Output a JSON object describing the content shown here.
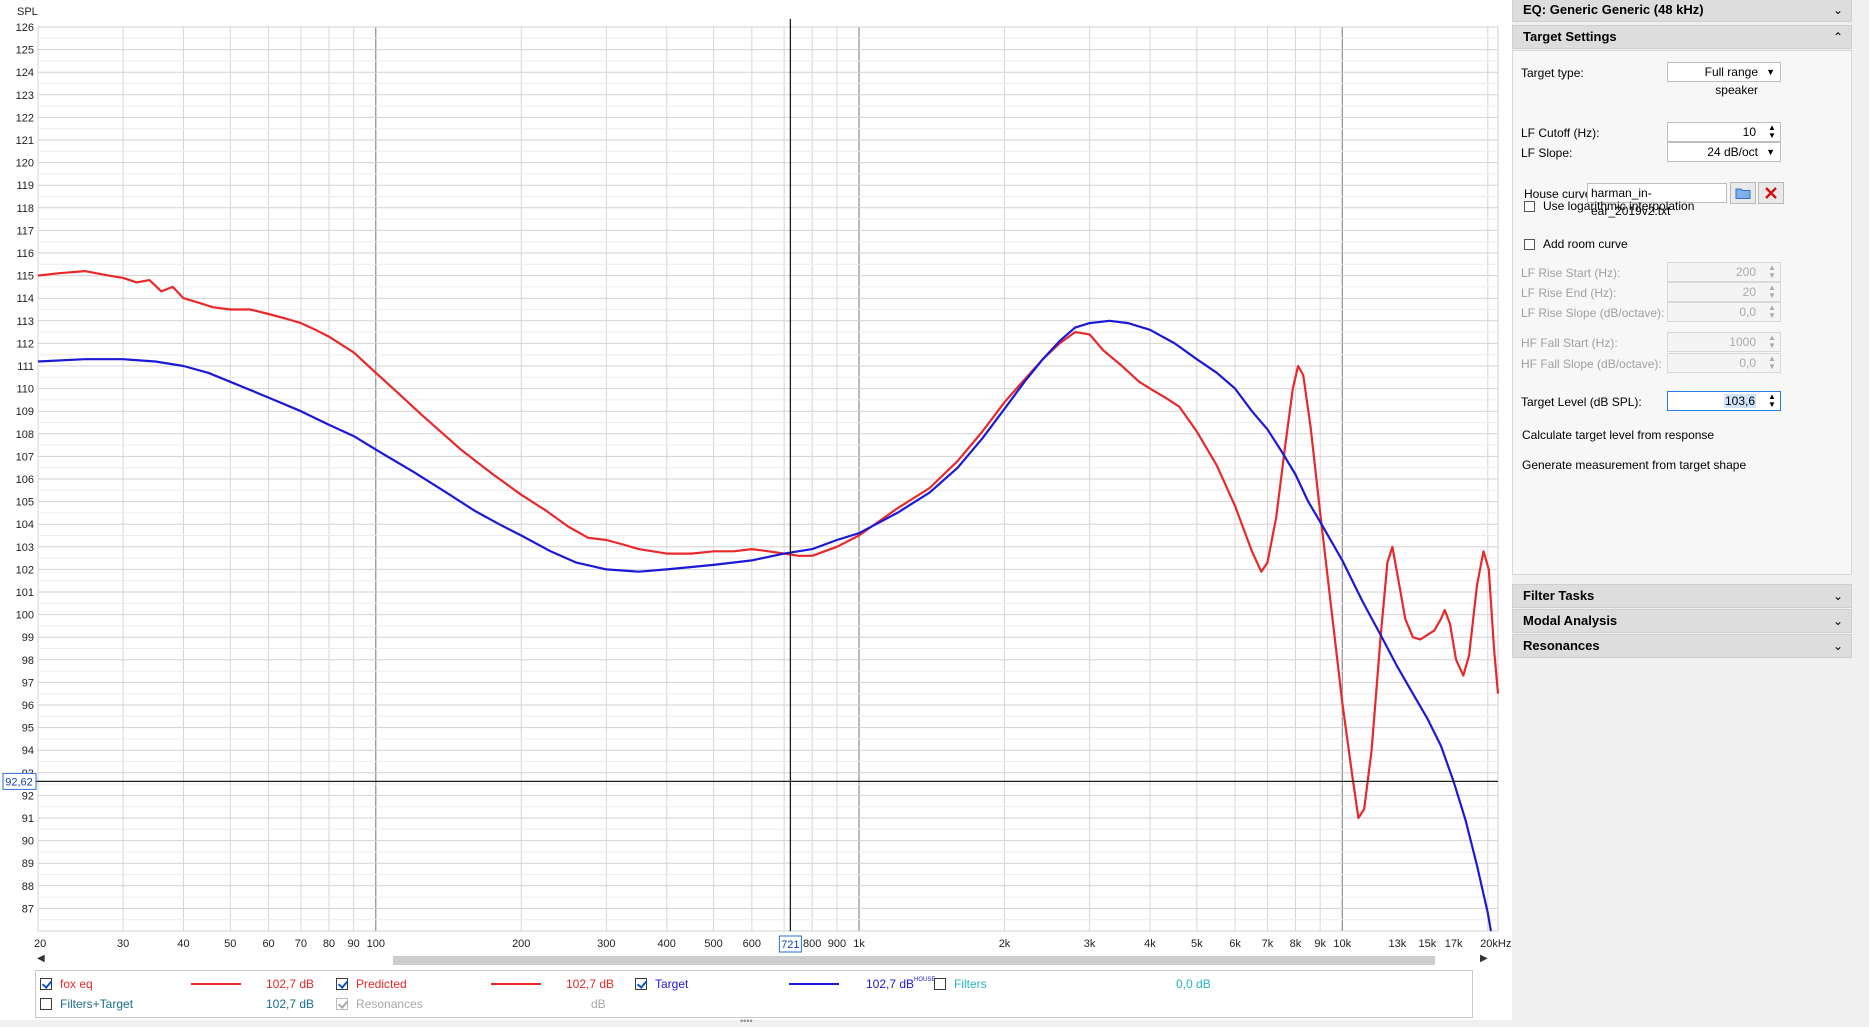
{
  "graph": {
    "y_axis_label": "SPL",
    "cursor": {
      "y_readout": "92,62",
      "x_readout": "721"
    }
  },
  "chart_data": {
    "type": "line",
    "xscale": "log",
    "xlim": [
      20,
      21000
    ],
    "ylim": [
      86,
      126
    ],
    "ylabel": "SPL",
    "grid": true,
    "y_ticks": [
      87,
      88,
      89,
      90,
      91,
      92,
      93,
      94,
      95,
      96,
      97,
      98,
      99,
      100,
      101,
      102,
      103,
      104,
      105,
      106,
      107,
      108,
      109,
      110,
      111,
      112,
      113,
      114,
      115,
      116,
      117,
      118,
      119,
      120,
      121,
      122,
      123,
      124,
      125,
      126
    ],
    "x_ticks": [
      {
        "v": 20,
        "label": "20"
      },
      {
        "v": 30,
        "label": "30"
      },
      {
        "v": 40,
        "label": "40"
      },
      {
        "v": 50,
        "label": "50"
      },
      {
        "v": 60,
        "label": "60"
      },
      {
        "v": 70,
        "label": "70"
      },
      {
        "v": 80,
        "label": "80"
      },
      {
        "v": 90,
        "label": "90"
      },
      {
        "v": 100,
        "label": "100"
      },
      {
        "v": 200,
        "label": "200"
      },
      {
        "v": 300,
        "label": "300"
      },
      {
        "v": 400,
        "label": "400"
      },
      {
        "v": 500,
        "label": "500"
      },
      {
        "v": 600,
        "label": "600"
      },
      {
        "v": 800,
        "label": "800"
      },
      {
        "v": 900,
        "label": "900"
      },
      {
        "v": 1000,
        "label": "1k"
      },
      {
        "v": 2000,
        "label": "2k"
      },
      {
        "v": 3000,
        "label": "3k"
      },
      {
        "v": 4000,
        "label": "4k"
      },
      {
        "v": 5000,
        "label": "5k"
      },
      {
        "v": 6000,
        "label": "6k"
      },
      {
        "v": 7000,
        "label": "7k"
      },
      {
        "v": 8000,
        "label": "8k"
      },
      {
        "v": 9000,
        "label": "9k"
      },
      {
        "v": 10000,
        "label": "10k"
      },
      {
        "v": 13000,
        "label": "13k"
      },
      {
        "v": 15000,
        "label": "15k"
      },
      {
        "v": 17000,
        "label": "17k"
      },
      {
        "v": 20000,
        "label": "20kHz"
      }
    ],
    "cursor": {
      "x": 721,
      "y": 92.62
    },
    "series": [
      {
        "name": "Predicted",
        "color": "#e8282b",
        "points": [
          [
            20,
            115.0
          ],
          [
            22,
            115.1
          ],
          [
            25,
            115.2
          ],
          [
            28,
            115.0
          ],
          [
            30,
            114.9
          ],
          [
            32,
            114.7
          ],
          [
            34,
            114.8
          ],
          [
            36,
            114.3
          ],
          [
            38,
            114.5
          ],
          [
            40,
            114.0
          ],
          [
            43,
            113.8
          ],
          [
            46,
            113.6
          ],
          [
            50,
            113.5
          ],
          [
            55,
            113.5
          ],
          [
            60,
            113.3
          ],
          [
            65,
            113.1
          ],
          [
            70,
            112.9
          ],
          [
            75,
            112.6
          ],
          [
            80,
            112.3
          ],
          [
            90,
            111.6
          ],
          [
            100,
            110.7
          ],
          [
            110,
            109.9
          ],
          [
            125,
            108.8
          ],
          [
            150,
            107.3
          ],
          [
            175,
            106.2
          ],
          [
            200,
            105.3
          ],
          [
            225,
            104.6
          ],
          [
            250,
            103.9
          ],
          [
            275,
            103.4
          ],
          [
            300,
            103.3
          ],
          [
            325,
            103.1
          ],
          [
            350,
            102.9
          ],
          [
            400,
            102.7
          ],
          [
            450,
            102.7
          ],
          [
            500,
            102.8
          ],
          [
            550,
            102.8
          ],
          [
            600,
            102.9
          ],
          [
            650,
            102.8
          ],
          [
            700,
            102.7
          ],
          [
            750,
            102.6
          ],
          [
            800,
            102.6
          ],
          [
            900,
            103.0
          ],
          [
            1000,
            103.5
          ],
          [
            1200,
            104.7
          ],
          [
            1400,
            105.6
          ],
          [
            1600,
            106.8
          ],
          [
            1800,
            108.1
          ],
          [
            2000,
            109.4
          ],
          [
            2200,
            110.4
          ],
          [
            2400,
            111.3
          ],
          [
            2600,
            112.0
          ],
          [
            2800,
            112.5
          ],
          [
            3000,
            112.4
          ],
          [
            3200,
            111.7
          ],
          [
            3500,
            111.0
          ],
          [
            3800,
            110.3
          ],
          [
            4000,
            110.0
          ],
          [
            4300,
            109.6
          ],
          [
            4600,
            109.2
          ],
          [
            5000,
            108.1
          ],
          [
            5500,
            106.6
          ],
          [
            6000,
            104.8
          ],
          [
            6500,
            102.8
          ],
          [
            6800,
            101.9
          ],
          [
            7000,
            102.3
          ],
          [
            7300,
            104.3
          ],
          [
            7600,
            107.3
          ],
          [
            7900,
            110.0
          ],
          [
            8100,
            111.0
          ],
          [
            8300,
            110.6
          ],
          [
            8600,
            108.3
          ],
          [
            9000,
            104.5
          ],
          [
            9500,
            100.2
          ],
          [
            10000,
            96.1
          ],
          [
            10500,
            92.8
          ],
          [
            10800,
            91.0
          ],
          [
            11100,
            91.4
          ],
          [
            11500,
            94.0
          ],
          [
            12000,
            99.0
          ],
          [
            12400,
            102.3
          ],
          [
            12700,
            103.0
          ],
          [
            13000,
            101.8
          ],
          [
            13500,
            99.8
          ],
          [
            14000,
            99.0
          ],
          [
            14500,
            98.9
          ],
          [
            15000,
            99.1
          ],
          [
            15500,
            99.3
          ],
          [
            16000,
            99.8
          ],
          [
            16300,
            100.2
          ],
          [
            16700,
            99.6
          ],
          [
            17200,
            98.0
          ],
          [
            17800,
            97.3
          ],
          [
            18300,
            98.2
          ],
          [
            19000,
            101.3
          ],
          [
            19600,
            102.8
          ],
          [
            20100,
            102.0
          ],
          [
            20600,
            98.5
          ],
          [
            21000,
            96.5
          ]
        ]
      },
      {
        "name": "Target",
        "color": "#1a1ad6",
        "points": [
          [
            20,
            111.2
          ],
          [
            25,
            111.3
          ],
          [
            30,
            111.3
          ],
          [
            35,
            111.2
          ],
          [
            40,
            111.0
          ],
          [
            45,
            110.7
          ],
          [
            50,
            110.3
          ],
          [
            60,
            109.6
          ],
          [
            70,
            109.0
          ],
          [
            80,
            108.4
          ],
          [
            90,
            107.9
          ],
          [
            100,
            107.3
          ],
          [
            120,
            106.3
          ],
          [
            140,
            105.4
          ],
          [
            160,
            104.6
          ],
          [
            180,
            104.0
          ],
          [
            200,
            103.5
          ],
          [
            230,
            102.8
          ],
          [
            260,
            102.3
          ],
          [
            300,
            102.0
          ],
          [
            350,
            101.9
          ],
          [
            400,
            102.0
          ],
          [
            500,
            102.2
          ],
          [
            600,
            102.4
          ],
          [
            700,
            102.7
          ],
          [
            800,
            102.9
          ],
          [
            900,
            103.3
          ],
          [
            1000,
            103.6
          ],
          [
            1200,
            104.5
          ],
          [
            1400,
            105.4
          ],
          [
            1600,
            106.5
          ],
          [
            1800,
            107.8
          ],
          [
            2000,
            109.1
          ],
          [
            2200,
            110.3
          ],
          [
            2400,
            111.3
          ],
          [
            2600,
            112.1
          ],
          [
            2800,
            112.7
          ],
          [
            3000,
            112.9
          ],
          [
            3300,
            113.0
          ],
          [
            3600,
            112.9
          ],
          [
            4000,
            112.6
          ],
          [
            4500,
            112.0
          ],
          [
            5000,
            111.3
          ],
          [
            5500,
            110.7
          ],
          [
            6000,
            110.0
          ],
          [
            6500,
            109.0
          ],
          [
            7000,
            108.2
          ],
          [
            7500,
            107.2
          ],
          [
            8000,
            106.2
          ],
          [
            8500,
            105.0
          ],
          [
            9000,
            104.1
          ],
          [
            10000,
            102.4
          ],
          [
            11000,
            100.6
          ],
          [
            12000,
            99.1
          ],
          [
            13000,
            97.7
          ],
          [
            14000,
            96.5
          ],
          [
            15000,
            95.4
          ],
          [
            16000,
            94.2
          ],
          [
            17000,
            92.6
          ],
          [
            18000,
            90.9
          ],
          [
            19000,
            88.9
          ],
          [
            20000,
            86.8
          ],
          [
            20300,
            86.0
          ]
        ]
      }
    ]
  },
  "legend": {
    "rows": [
      [
        {
          "name": "fox eq",
          "value": "102,7 dB",
          "checked": true,
          "color": "#e8282b",
          "text_color": "#e8282b"
        },
        {
          "name": "Predicted",
          "value": "102,7 dB",
          "checked": true,
          "color": "#e8282b",
          "text_color": "#e8282b"
        },
        {
          "name": "Target",
          "value": "102,7 dB",
          "checked": true,
          "color": "#1a1ad6",
          "text_color": "#1a1ad6",
          "value_suffix": "HOUSE"
        },
        {
          "name": "Filters",
          "value": "0,0 dB",
          "checked": false,
          "color": "",
          "text_color": "#27b3c2"
        }
      ],
      [
        {
          "name": "Filters+Target",
          "value": "102,7 dB",
          "checked": false,
          "color": "",
          "text_color": "#1b6f86"
        },
        {
          "name": "Resonances",
          "value": "dB",
          "checked": true,
          "color": "",
          "text_color": "#a9a9a9",
          "disabled": true
        }
      ]
    ]
  },
  "side": {
    "eq_header": "EQ: Generic Generic (48 kHz)",
    "target_header": "Target Settings",
    "target_type_label": "Target type:",
    "target_type_value": "Full range speaker",
    "lf_cutoff_label": "LF Cutoff (Hz):",
    "lf_cutoff_value": "10",
    "lf_slope_label": "LF Slope:",
    "lf_slope_value": "24 dB/oct",
    "house_curve_label": "House curve:",
    "house_curve_value": "harman_in-ear_2019v2.txt",
    "log_interp_label": "Use logarithmic interpolation",
    "add_room_label": "Add room curve",
    "lf_rise_start_label": "LF Rise Start (Hz):",
    "lf_rise_start_value": "200",
    "lf_rise_end_label": "LF Rise End (Hz):",
    "lf_rise_end_value": "20",
    "lf_rise_slope_label": "LF Rise Slope (dB/octave):",
    "lf_rise_slope_value": "0,0",
    "hf_fall_start_label": "HF Fall Start (Hz):",
    "hf_fall_start_value": "1000",
    "hf_fall_slope_label": "HF Fall Slope (dB/octave):",
    "hf_fall_slope_value": "0,0",
    "target_level_label": "Target Level (dB SPL):",
    "target_level_value": "103,6",
    "calc_label": "Calculate target level from response",
    "generate_label": "Generate measurement from target shape",
    "filter_tasks_header": "Filter Tasks",
    "modal_header": "Modal Analysis",
    "resonances_header": "Resonances"
  }
}
